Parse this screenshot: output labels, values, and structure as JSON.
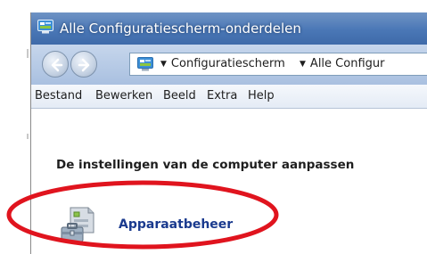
{
  "window": {
    "title": "Alle Configuratiescherm-onderdelen"
  },
  "navigation": {
    "back_icon": "arrow-left-icon",
    "forward_icon": "arrow-right-icon",
    "breadcrumbs": [
      {
        "label": "Configuratiescherm"
      },
      {
        "label": "Alle Configur"
      }
    ]
  },
  "menu": {
    "items": [
      {
        "label": "Bestand"
      },
      {
        "label": "Bewerken"
      },
      {
        "label": "Beeld"
      },
      {
        "label": "Extra"
      },
      {
        "label": "Help"
      }
    ]
  },
  "content": {
    "heading": "De instellingen van de computer aanpassen",
    "items": [
      {
        "label": "Apparaatbeheer",
        "icon": "device-manager-icon"
      }
    ]
  },
  "annotation": {
    "shape": "ellipse",
    "color": "#e0141e"
  }
}
